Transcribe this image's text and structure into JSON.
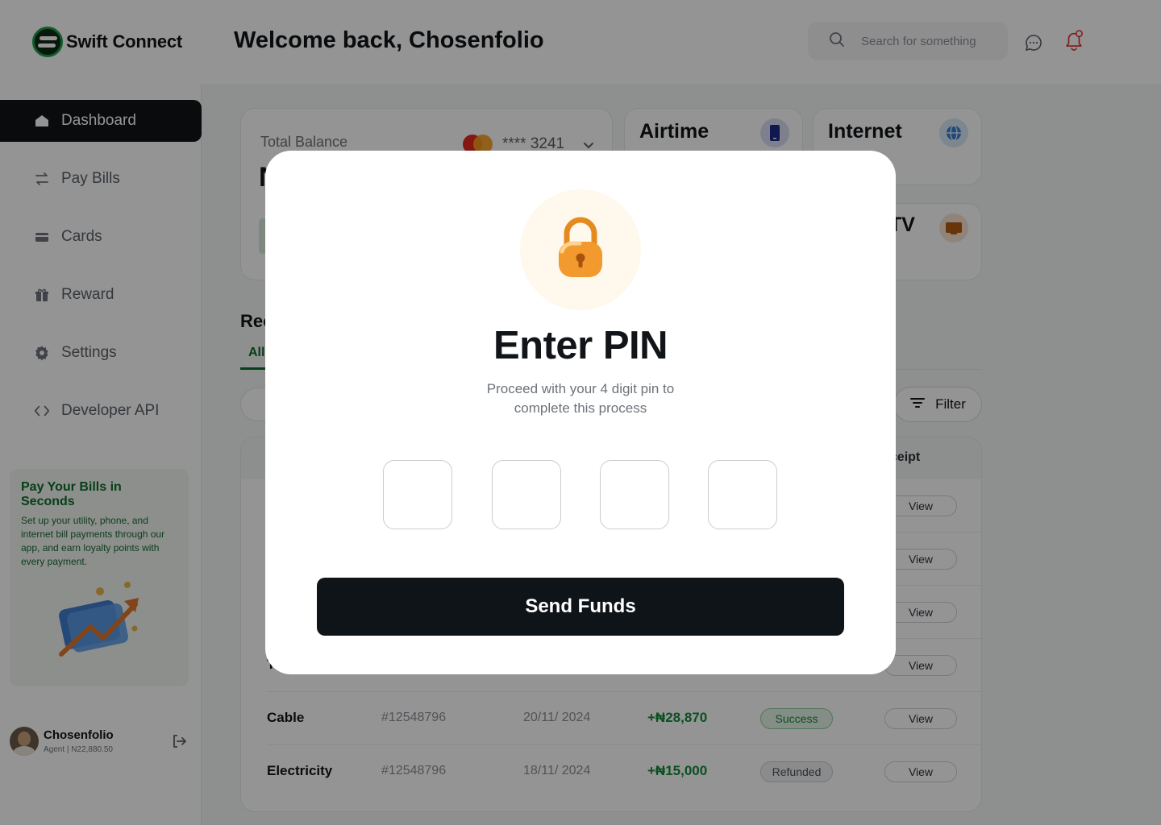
{
  "app": {
    "name": "Swift Connect",
    "welcome": "Welcome back, Chosenfolio"
  },
  "search": {
    "placeholder": "Search for something"
  },
  "icons": {
    "search": "search-icon",
    "chat": "chat-icon",
    "bell": "bell-icon",
    "dashboard": "home-icon",
    "pay_bills": "transfer-arrows-icon",
    "cards": "card-icon",
    "reward": "gift-icon",
    "settings": "gear-icon",
    "developer_api": "code-brackets-icon",
    "logout": "logout-icon",
    "lock": "padlock-icon",
    "filter": "filter-icon"
  },
  "sidebar": {
    "items": [
      {
        "label": "Dashboard",
        "active": true
      },
      {
        "label": "Pay Bills",
        "active": false
      },
      {
        "label": "Cards",
        "active": false
      },
      {
        "label": "Reward",
        "active": false
      },
      {
        "label": "Settings",
        "active": false
      },
      {
        "label": "Developer API",
        "active": false
      }
    ],
    "promo": {
      "title": "Pay Your Bills in Seconds",
      "text": "Set up your utility, phone, and internet bill payments through our app, and earn loyalty points with every payment."
    },
    "profile": {
      "name": "Chosenfolio",
      "sub": "Agent | N22,880.50"
    }
  },
  "balance": {
    "label": "Total Balance",
    "card_number": "**** 3241",
    "value_partial": "N"
  },
  "services": {
    "airtime": "Airtime",
    "internet": "Internet",
    "tv_partial": "TV"
  },
  "recent": {
    "title_partial": "Rec",
    "tab_all": "All",
    "filter_label": "Filter",
    "receipt_header_partial": "eceipt"
  },
  "transactions": [
    {
      "type": "",
      "ref": "",
      "date": "",
      "amount": "",
      "status": "",
      "action": "View"
    },
    {
      "type": "",
      "ref": "",
      "date": "",
      "amount": "",
      "status": "",
      "action": "View"
    },
    {
      "type": "",
      "ref": "",
      "date": "",
      "amount": "",
      "status": "",
      "action": "View"
    },
    {
      "type": "T",
      "ref": "",
      "date": "",
      "amount": "",
      "status": "",
      "action": "View"
    },
    {
      "type": "Cable",
      "ref": "#12548796",
      "date": "20/11/ 2024",
      "amount": "+₦28,870",
      "status": "Success",
      "action": "View"
    },
    {
      "type": "Electricity",
      "ref": "#12548796",
      "date": "18/11/ 2024",
      "amount": "+₦15,000",
      "status": "Refunded",
      "action": "View"
    }
  ],
  "modal": {
    "title": "Enter PIN",
    "subtitle": "Proceed with your 4 digit pin to complete this process",
    "pin_values": [
      "",
      "",
      "",
      ""
    ],
    "submit_label": "Send Funds"
  },
  "colors": {
    "brand_dark": "#111418",
    "brand_green": "#0e6b2c",
    "success": "#138a3a",
    "overlay": "rgba(0,0,0,0.42)"
  }
}
